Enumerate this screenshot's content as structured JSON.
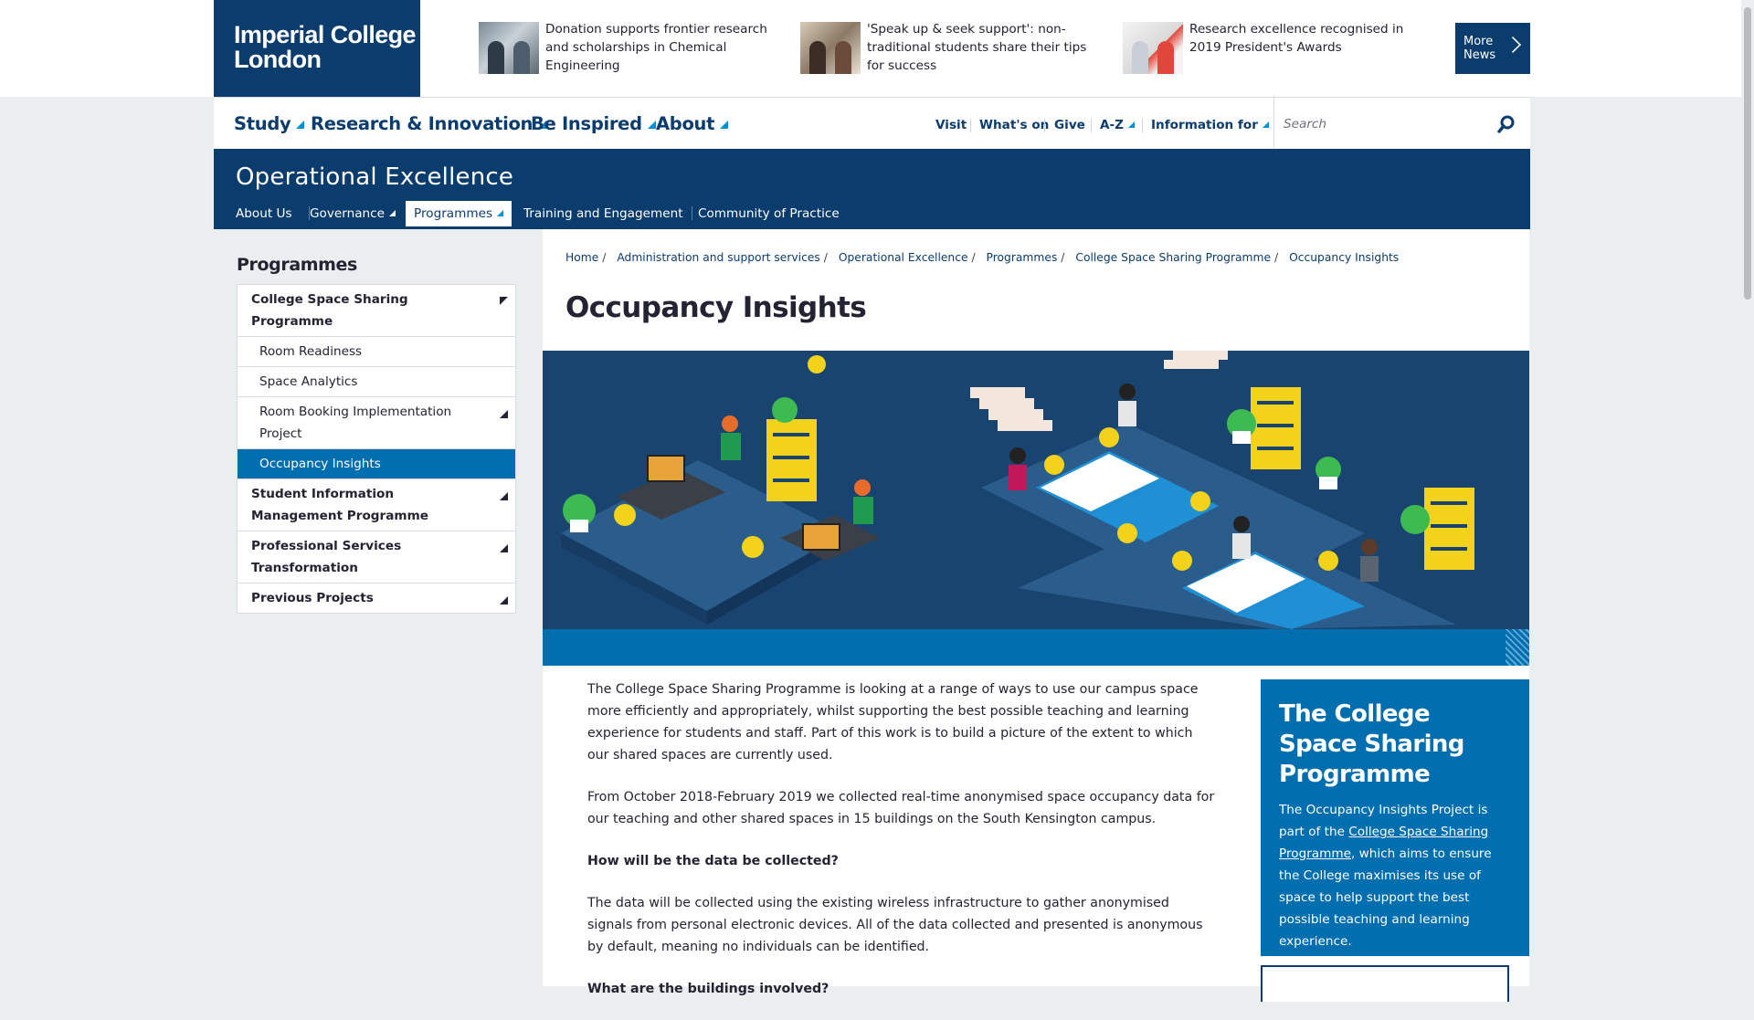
{
  "logo": {
    "line1": "Imperial College",
    "line2": "London"
  },
  "news": [
    {
      "text": "Donation supports frontier research and scholarships in Chemical Engineering"
    },
    {
      "text": "'Speak up & seek support': non-traditional students share their tips for success"
    },
    {
      "text": "Research excellence recognised in 2019 President's Awards"
    }
  ],
  "more_news": {
    "line1": "More",
    "line2": "News"
  },
  "main_nav": [
    "Study",
    "Research & Innovation",
    "Be Inspired",
    "About"
  ],
  "utility_nav": [
    "Visit",
    "What's on",
    "Give",
    "A-Z",
    "Information for"
  ],
  "search": {
    "placeholder": "Search"
  },
  "section": {
    "title": "Operational Excellence",
    "nav": [
      "About Us",
      "Governance",
      "Programmes",
      "Training and Engagement",
      "Community of Practice"
    ]
  },
  "sidebar": {
    "heading": "Programmes",
    "items": [
      {
        "label": "College Space Sharing Programme"
      },
      {
        "label": "Room Readiness"
      },
      {
        "label": "Space Analytics"
      },
      {
        "label": "Room Booking Implementation Project"
      },
      {
        "label": "Occupancy Insights"
      },
      {
        "label": "Student Information Management Programme"
      },
      {
        "label": "Professional Services Transformation"
      },
      {
        "label": "Previous Projects"
      }
    ]
  },
  "breadcrumb": [
    "Home",
    "Administration and support services",
    "Operational Excellence",
    "Programmes",
    "College Space Sharing Programme",
    "Occupancy Insights"
  ],
  "page_title": "Occupancy Insights",
  "body": {
    "p1": "The College Space Sharing Programme is looking at a range of ways to use our campus space more efficiently and appropriately, whilst supporting the best possible teaching and learning experience for students and staff. Part of this work is to build a picture of the extent to which our shared spaces are currently used.",
    "p2": "From October 2018-February 2019 we collected real-time anonymised space occupancy data for our teaching and other shared spaces in 15 buildings on the South Kensington campus.",
    "q1": "How will be the data be collected?",
    "p3": "The data will be collected using the existing wireless infrastructure to gather anonymised signals from personal electronic devices.  All of the data collected and presented is anonymous by default, meaning no individuals can be identified.",
    "q2": "What are the buildings involved?"
  },
  "info_box": {
    "title": "The College Space Sharing Programme",
    "text_before": "The Occupancy Insights Project is part of the ",
    "link": "College Space Sharing Programme",
    "text_after": ", which aims to ensure the College maximises its use of space to help support the best possible teaching and learning experience."
  },
  "colors": {
    "navy": "#0b3c6e",
    "blue": "#006eaf",
    "accent": "#0091d4",
    "yellow": "#f2d21b"
  },
  "icons": {
    "search": "search-icon",
    "chevron": "chevron-right-icon"
  }
}
